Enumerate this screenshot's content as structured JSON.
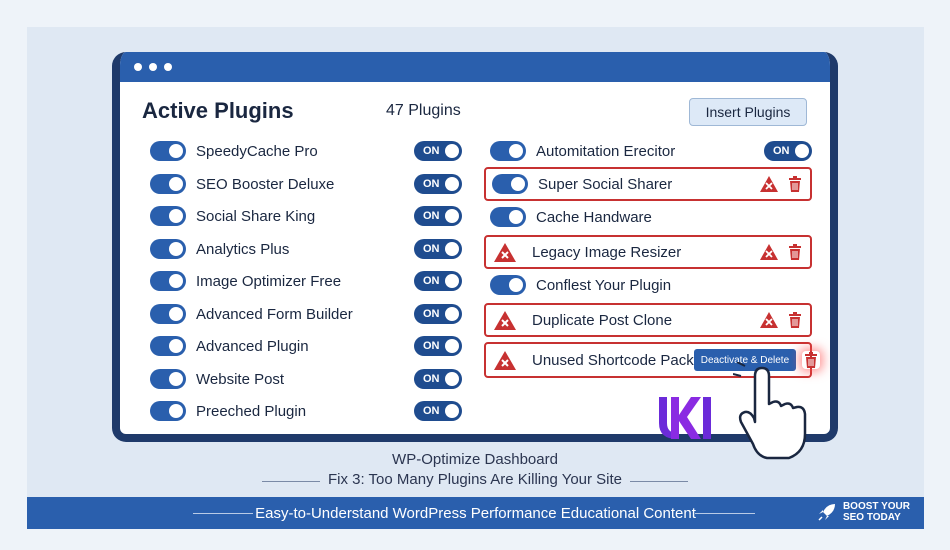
{
  "header": {
    "title": "Active Plugins",
    "count": "47 Plugins",
    "insert_label": "Insert Plugins"
  },
  "left_plugins": [
    {
      "name": "SpeedyCache Pro",
      "state": "ON"
    },
    {
      "name": "SEO Booster Deluxe",
      "state": "ON"
    },
    {
      "name": "Social Share King",
      "state": "ON"
    },
    {
      "name": "Analytics Plus",
      "state": "ON"
    },
    {
      "name": "Image Optimizer Free",
      "state": "ON"
    },
    {
      "name": "Advanced Form Builder",
      "state": "ON"
    },
    {
      "name": "Advanced Plugin",
      "state": "ON"
    },
    {
      "name": "Website Post",
      "state": "ON"
    },
    {
      "name": "Preeched Plugin",
      "state": "ON"
    }
  ],
  "right_plugins": [
    {
      "name": "Automitation Erecitor",
      "state": "ON",
      "flagged": false
    },
    {
      "name": "Super Social Sharer",
      "flagged": true,
      "has_error": false
    },
    {
      "name": "Cache Handware",
      "flagged": false
    },
    {
      "name": "Legacy Image Resizer",
      "flagged": true,
      "has_error": true
    },
    {
      "name": "Conflest Your Plugin",
      "flagged": false
    },
    {
      "name": "Duplicate Post Clone",
      "flagged": true,
      "has_error": true
    },
    {
      "name": "Unused Shortcode Pack",
      "flagged": true,
      "has_error": true,
      "action_label": "Deactivate & Delete"
    }
  ],
  "caption": {
    "line1": "WP-Optimize Dashboard",
    "line2": "Fix 3: Too Many Plugins Are Killing Your Site"
  },
  "footer": {
    "text": "Easy-to-Understand WordPress Performance Educational Content",
    "brand_line1": "BOOST YOUR",
    "brand_line2": "SEO TODAY"
  },
  "colors": {
    "primary": "#2a5fad",
    "danger": "#c73131",
    "frame": "#1f3a6a"
  },
  "icons": {
    "toggle": "toggle-on-icon",
    "warning": "warning-triangle-icon",
    "trash": "trash-icon",
    "error": "error-triangle-icon",
    "pointer": "hand-pointer-icon",
    "logo": "uki-logo",
    "rocket": "rocket-icon"
  }
}
